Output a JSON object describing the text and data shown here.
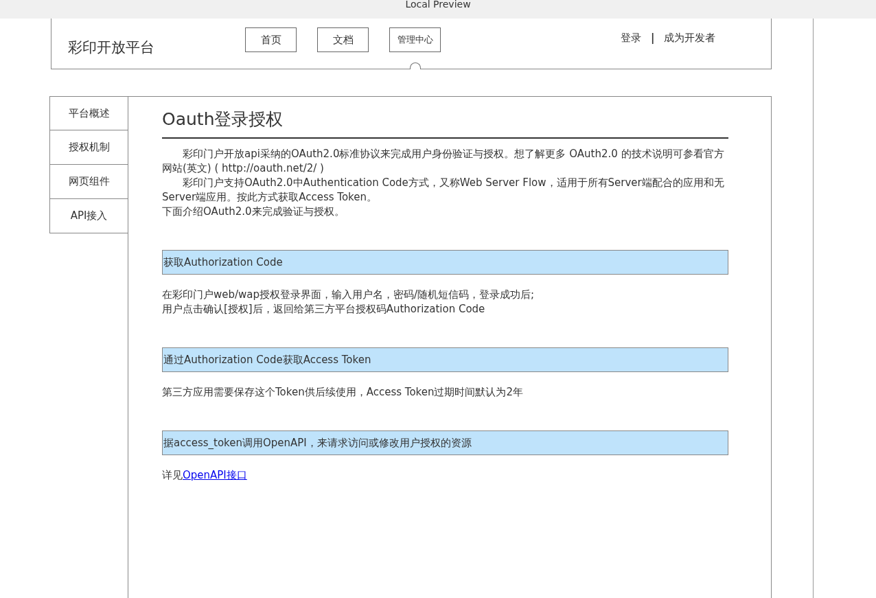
{
  "window": {
    "title": "Local Preview"
  },
  "header": {
    "logo": "彩印开放平台",
    "nav": [
      {
        "label": "首页",
        "selected": false
      },
      {
        "label": "文档",
        "selected": false
      },
      {
        "label": "管理中心",
        "selected": true
      }
    ],
    "login": "登录",
    "separator": "|",
    "register": "成为开发者"
  },
  "sidebar": {
    "items": [
      {
        "label": "平台概述",
        "selected": false
      },
      {
        "label": "授权机制",
        "selected": false
      },
      {
        "label": "网页组件",
        "selected": false
      },
      {
        "label": "API接入",
        "selected": false
      }
    ]
  },
  "content": {
    "title": "Oauth登录授权",
    "intro": [
      {
        "text": "彩印门户开放api采纳的OAuth2.0标准协议来完成用户身份验证与授权。想了解更多 OAuth2.0 的技术说明可参看官方网站(英文) ( http://oauth.net/2/ )",
        "indent": true
      },
      {
        "text": "彩印门户支持OAuth2.0中Authentication Code方式，又称Web Server Flow，适用于所有Server端配合的应用和无Server端应用。按此方式获取Access Token。",
        "indent": true
      },
      {
        "text": "下面介绍OAuth2.0来完成验证与授权。",
        "indent": false
      }
    ],
    "sections": [
      {
        "heading": "获取Authorization Code",
        "lines": [
          {
            "text": "在彩印门户web/wap授权登录界面，输入用户名，密码/随机短信码，登录成功后;"
          },
          {
            "text": "用户点击确认[授权]后，返回给第三方平台授权码Authorization Code"
          }
        ]
      },
      {
        "heading": "通过Authorization Code获取Access Token",
        "lines": [
          {
            "text": "第三方应用需要保存这个Token供后续使用，Access Token过期时间默认为2年"
          }
        ]
      },
      {
        "heading": "据access_token调用OpenAPI，来请求访问或修改用户授权的资源",
        "lines": [
          {
            "text": "详见",
            "link": "OpenAPI接口"
          }
        ]
      }
    ]
  }
}
